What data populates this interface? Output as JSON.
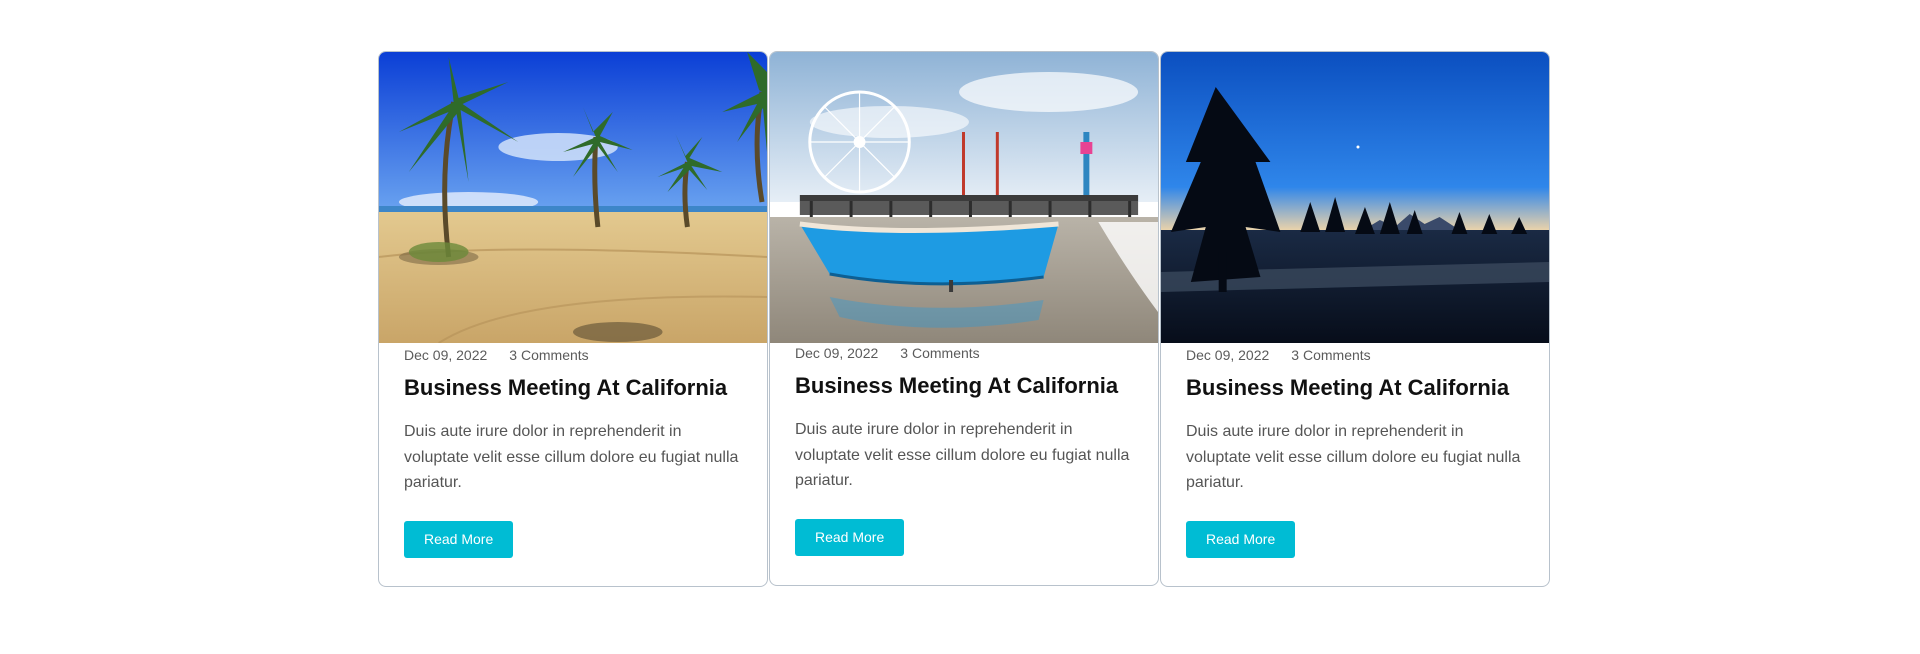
{
  "cards": [
    {
      "image": "palm-beach-photo",
      "date": "Dec 09, 2022",
      "comments": "3 Comments",
      "title": "Business Meeting At California",
      "excerpt": "Duis aute irure dolor in reprehenderit in voluptate velit esse cillum dolore eu fugiat nulla pariatur.",
      "button": "Read More"
    },
    {
      "image": "pier-boat-photo",
      "date": "Dec 09, 2022",
      "comments": "3 Comments",
      "title": "Business Meeting At California",
      "excerpt": "Duis aute irure dolor in reprehenderit in voluptate velit esse cillum dolore eu fugiat nulla pariatur.",
      "button": "Read More"
    },
    {
      "image": "night-forest-photo",
      "date": "Dec 09, 2022",
      "comments": "3 Comments",
      "title": "Business Meeting At California",
      "excerpt": "Duis aute irure dolor in reprehenderit in voluptate velit esse cillum dolore eu fugiat nulla pariatur.",
      "button": "Read More"
    }
  ],
  "colors": {
    "accent": "#00bcd4",
    "border": "#b8c2cc",
    "title": "#111111",
    "text": "#555555"
  }
}
